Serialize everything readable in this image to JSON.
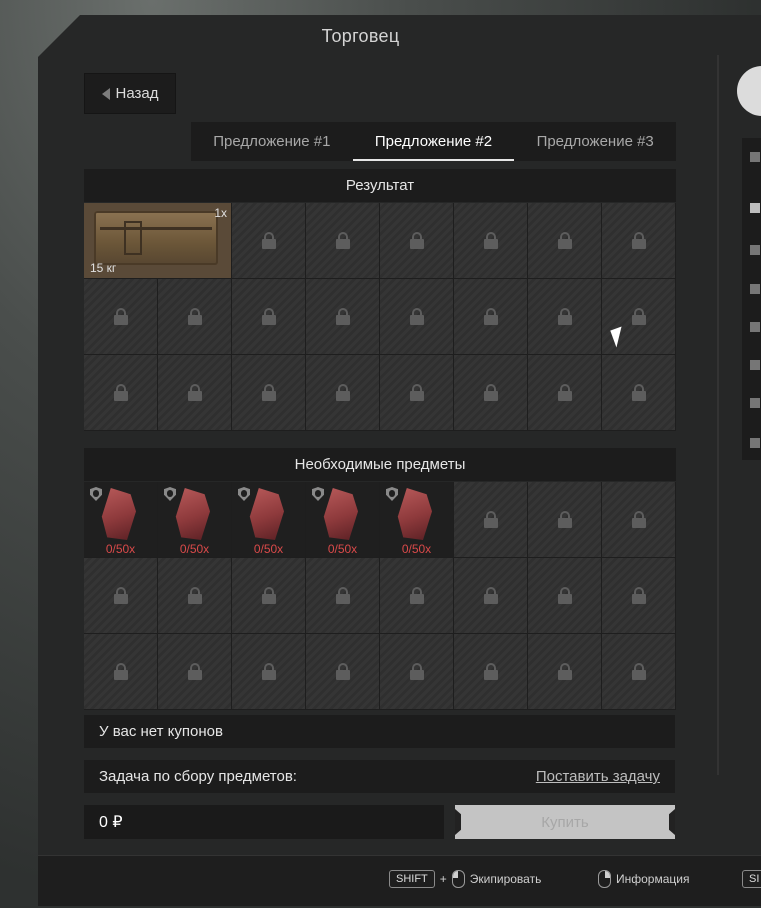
{
  "window": {
    "title": "Торговец"
  },
  "back_button": {
    "label": "Назад"
  },
  "tabs": [
    {
      "label": "Предложение #1",
      "active": false
    },
    {
      "label": "Предложение #2",
      "active": true
    },
    {
      "label": "Предложение #3",
      "active": false
    }
  ],
  "result": {
    "header": "Результат",
    "item": {
      "name": "crate-icon",
      "quantity": "1x",
      "weight": "15 кг"
    },
    "locked_cell_count": 22
  },
  "required": {
    "header": "Необходимые предметы",
    "items": [
      {
        "icon": "crystal-shard-icon",
        "progress": "0/50x"
      },
      {
        "icon": "crystal-shard-icon",
        "progress": "0/50x"
      },
      {
        "icon": "crystal-shard-icon",
        "progress": "0/50x"
      },
      {
        "icon": "crystal-shard-icon",
        "progress": "0/50x"
      },
      {
        "icon": "crystal-shard-icon",
        "progress": "0/50x"
      }
    ],
    "locked_cell_count": 19
  },
  "coupons": {
    "text": "У вас нет купонов"
  },
  "task": {
    "label": "Задача по сбору предметов:",
    "link": "Поставить задачу"
  },
  "price": {
    "value": "0 ₽"
  },
  "buy_button": {
    "label": "Купить"
  },
  "footer_hints": [
    {
      "key": "SHIFT",
      "plus": "+",
      "mouse": "left",
      "label": "Экипировать"
    },
    {
      "mouse": "right",
      "label": "Информация"
    },
    {
      "key": "SI"
    }
  ],
  "colors": {
    "window_bg": "#262727",
    "panel_bg": "#1c1c1c",
    "required_text": "#d94a4a"
  }
}
